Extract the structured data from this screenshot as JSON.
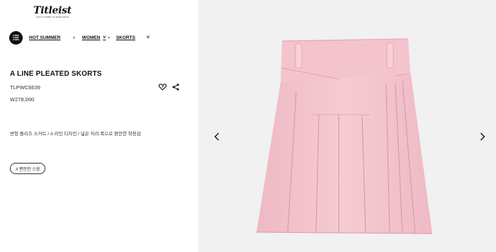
{
  "brand": {
    "logo_text": "Titleist",
    "tagline": "GOLF'S SYMBOL OF EXCELLENCE"
  },
  "breadcrumb": [
    {
      "label": "HOT SUMMER"
    },
    {
      "label": "WOMEN"
    },
    {
      "label": "SKORTS"
    }
  ],
  "product": {
    "name": "A LINE PLEATED SKORTS",
    "code": "TLPWC6639",
    "price": "W278,000",
    "description": "변형 플리츠 스커트 / A 라인 디자인 / 넓은 허리 폭으로 편안한 착용감",
    "tag": "# 편안한 스윙",
    "image_color": "#f3c7d0"
  },
  "icons": {
    "menu": "menu-list-icon",
    "wishlist": "heart-icon",
    "share": "share-icon",
    "prev": "chevron-left-icon",
    "next": "chevron-right-icon"
  }
}
